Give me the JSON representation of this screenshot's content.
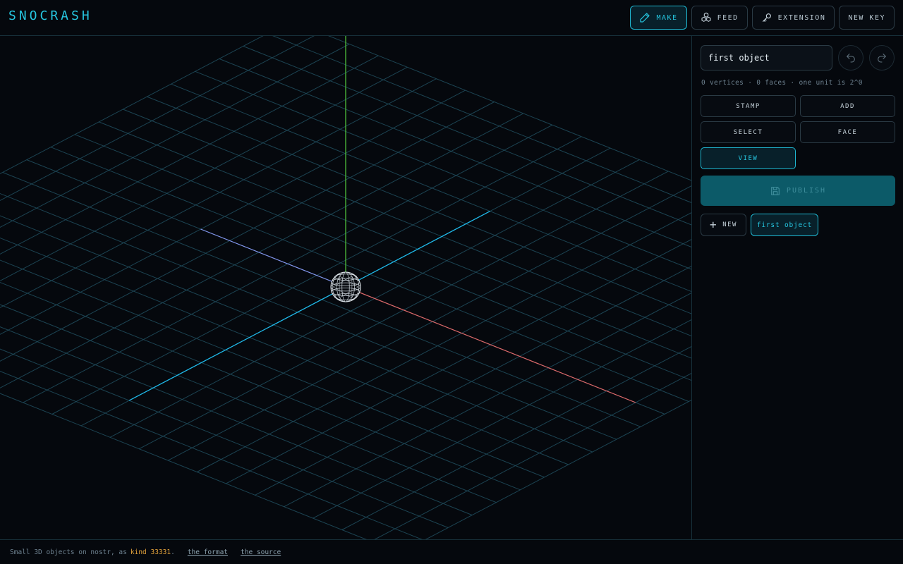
{
  "header": {
    "logo": "SNOCRASH",
    "nav": [
      {
        "label": "MAKE",
        "icon": "pencil-icon",
        "active": true
      },
      {
        "label": "FEED",
        "icon": "cubes-icon",
        "active": false
      },
      {
        "label": "EXTENSION",
        "icon": "key-icon",
        "active": false
      },
      {
        "label": "NEW KEY",
        "icon": "",
        "active": false
      }
    ]
  },
  "sidebar": {
    "object_name": "first object",
    "stats": "0 vertices · 0 faces · one unit is 2^0",
    "tools": [
      {
        "label": "STAMP",
        "active": false
      },
      {
        "label": "ADD",
        "active": false
      },
      {
        "label": "SELECT",
        "active": false
      },
      {
        "label": "FACE",
        "active": false
      },
      {
        "label": "VIEW",
        "active": true
      }
    ],
    "publish_label": "PUBLISH",
    "new_label": "NEW",
    "objects": [
      "first object"
    ]
  },
  "footer": {
    "text": "Small 3D objects on nostr, as",
    "kind": "kind 33331",
    "kind_suffix": ".",
    "link_format": "the format",
    "link_source": "the source"
  },
  "colors": {
    "accent": "#26c6e0",
    "grid": "#1f4a5a",
    "axis_x": "#e86a6a",
    "axis_y": "#4fbf3a",
    "axis_z": "#1fb8e8",
    "publish_bg": "#0c5a68",
    "kind": "#e3a33b"
  }
}
